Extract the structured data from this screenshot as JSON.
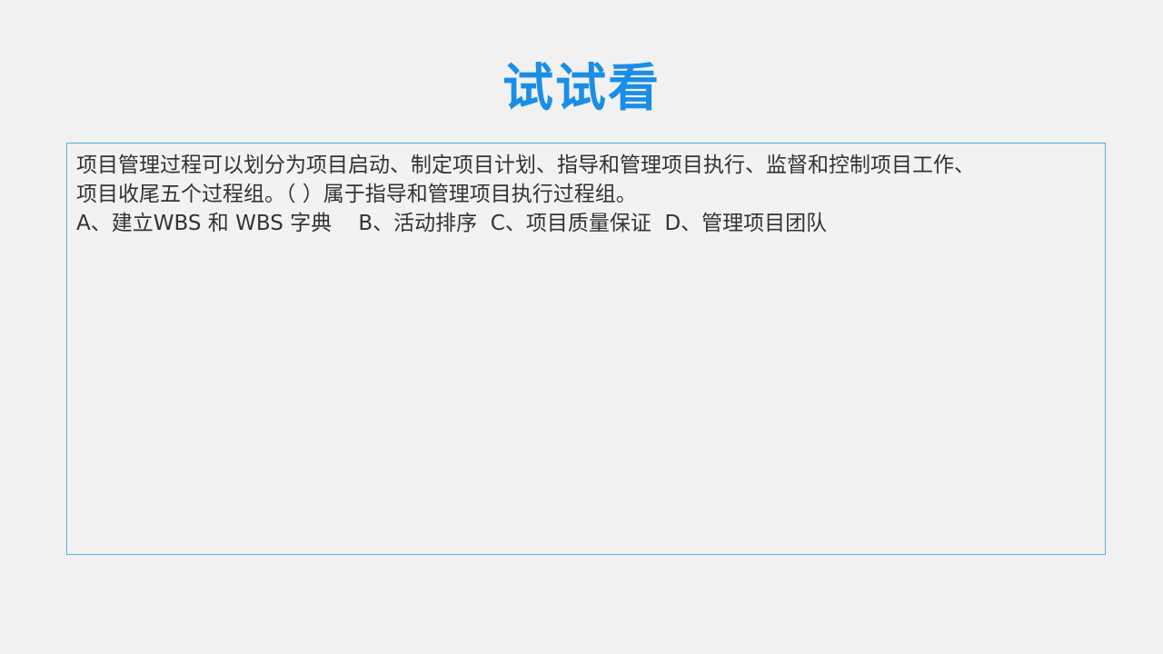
{
  "slide": {
    "title": "试试看"
  },
  "question": {
    "stem_line1": "项目管理过程可以划分为项目启动、制定项目计划、指导和管理项目执行、监督和控制项目工作、",
    "stem_line2": "项目收尾五个过程组。（   ）属于指导和管理项目执行过程组。",
    "options": [
      "A、建立WBS 和 WBS 字典",
      "B、活动排序",
      "C、项目质量保证",
      "D、管理项目团队"
    ]
  },
  "colors": {
    "background": "#f1f1f1",
    "title": "#1a8ee6",
    "box_border": "#4db1dd",
    "text": "#333333"
  }
}
